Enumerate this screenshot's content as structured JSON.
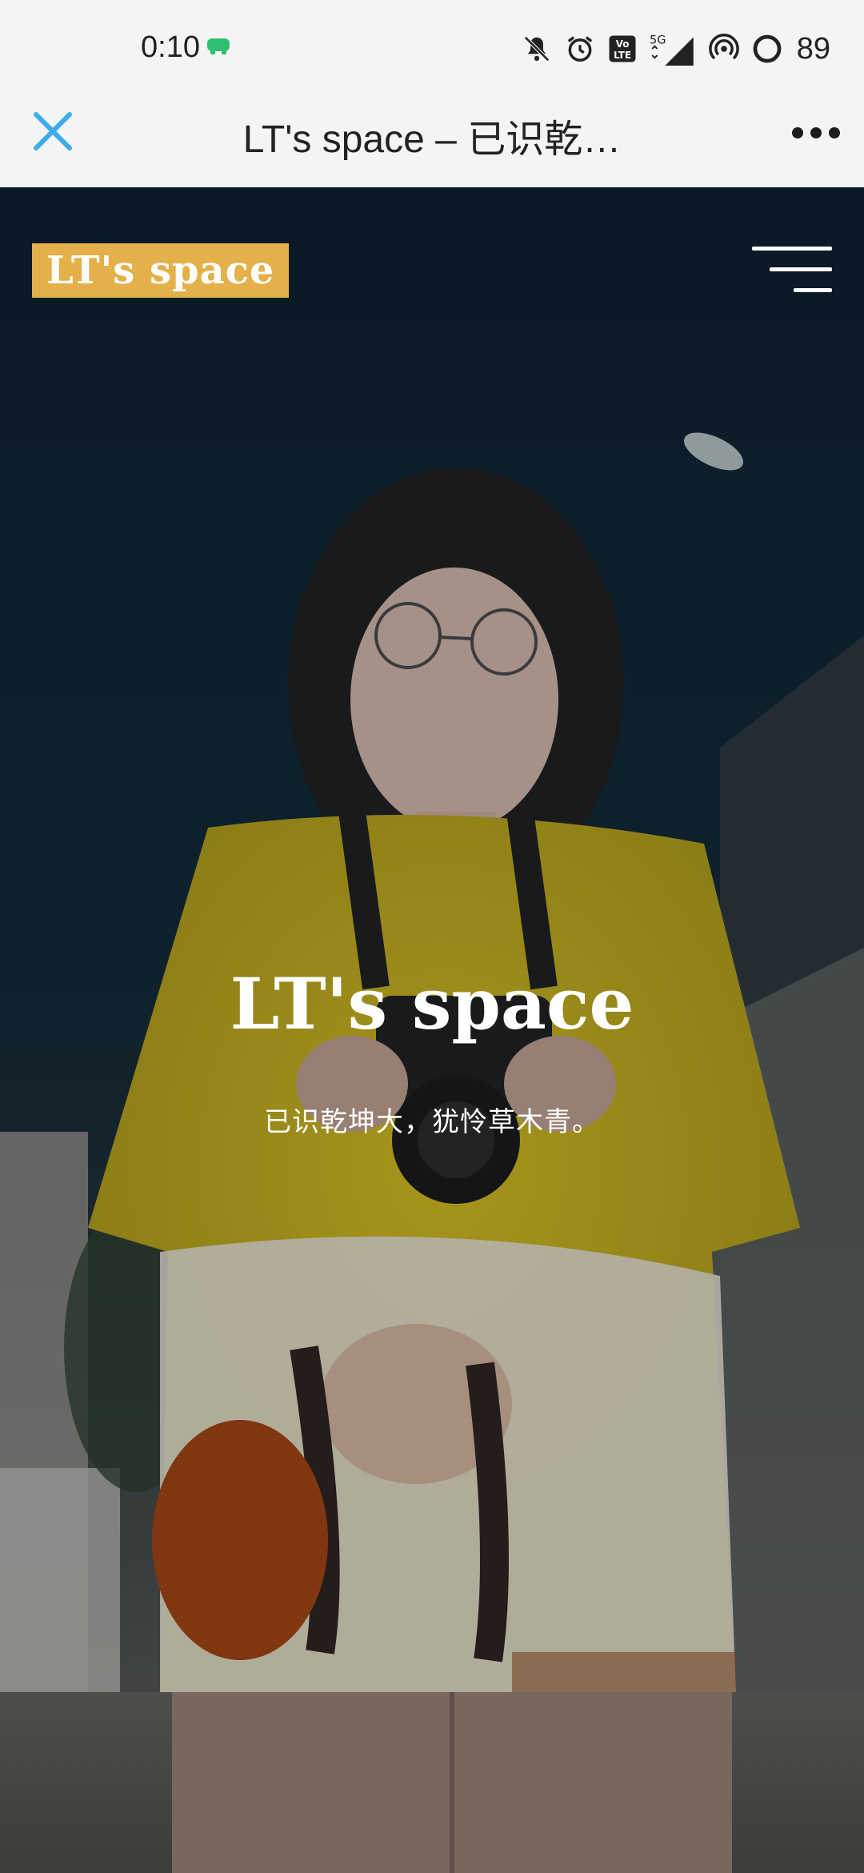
{
  "status_bar": {
    "time": "0:10",
    "battery_level": "89",
    "network": "5G",
    "icons": [
      "app-notification-icon",
      "mute-icon",
      "alarm-icon",
      "volte-icon",
      "signal-icon",
      "hotspot-icon",
      "battery-icon"
    ]
  },
  "browser": {
    "title": "LT's space – 已识乾…",
    "close_icon": "close-icon",
    "more_icon": "more-options-icon",
    "accent_color": "#3daee9"
  },
  "site": {
    "logo_text": "LT's space",
    "logo_color": "#e4b04a",
    "menu_icon": "hamburger-menu-icon"
  },
  "hero": {
    "title": "LT's space",
    "subtitle": "已识乾坤大，犹怜草木青。"
  }
}
